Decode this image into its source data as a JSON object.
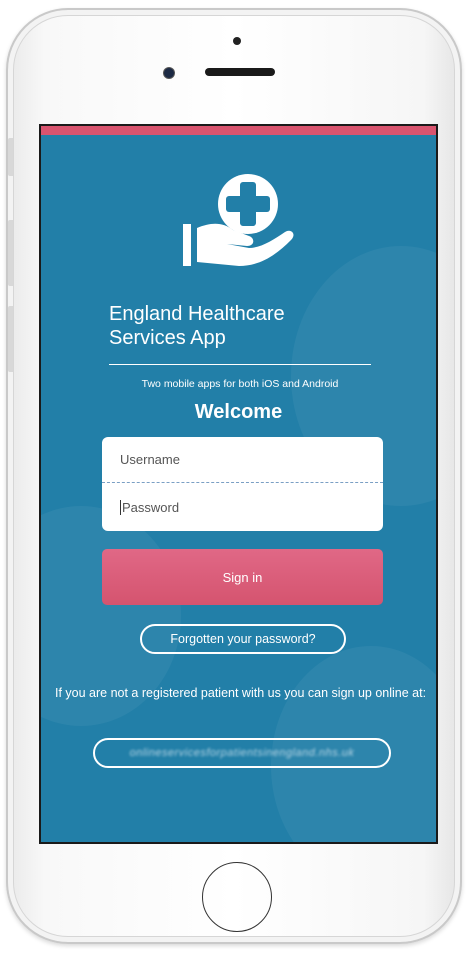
{
  "app": {
    "title_line1": "England Healthcare",
    "title_line2": "Services App",
    "subtitle": "Two mobile apps for both iOS and Android",
    "welcome": "Welcome"
  },
  "login": {
    "username_placeholder": "Username",
    "password_placeholder": "Password",
    "sign_in_label": "Sign in",
    "forgot_label": "Forgotten your password?"
  },
  "registration": {
    "message": "If you are not a registered patient with us you can sign up online at:",
    "link_text": "onlineservicesforpatientsinengland.nhs.uk"
  },
  "icons": {
    "logo": "hand-medical-cross-icon"
  },
  "colors": {
    "screen_bg": "#227fa8",
    "accent": "#d9546f",
    "white": "#ffffff"
  }
}
